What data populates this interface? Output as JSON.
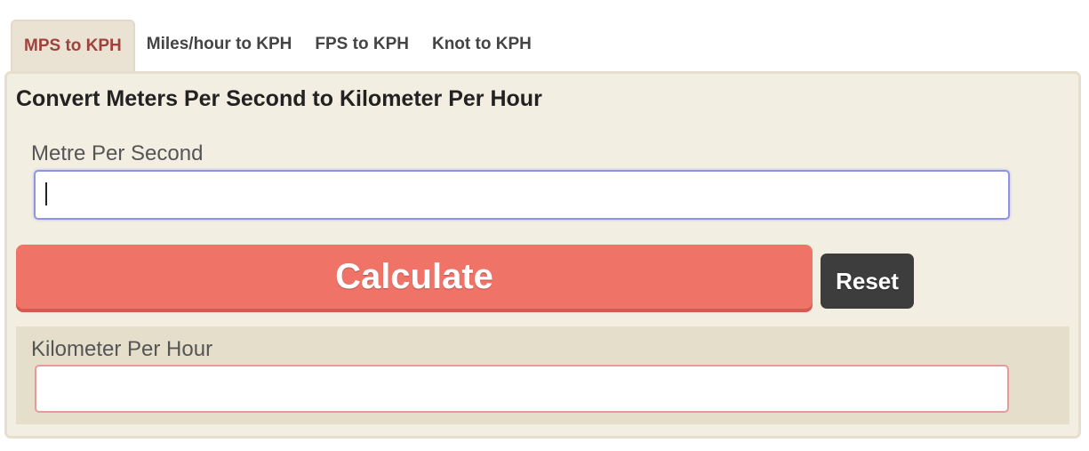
{
  "tabs": [
    {
      "label": "MPS to KPH",
      "active": true
    },
    {
      "label": "Miles/hour to KPH",
      "active": false
    },
    {
      "label": "FPS to KPH",
      "active": false
    },
    {
      "label": "Knot to KPH",
      "active": false
    }
  ],
  "converter": {
    "title": "Convert Meters Per Second to Kilometer Per Hour",
    "input_label": "Metre Per Second",
    "input_value": "",
    "calculate_label": "Calculate",
    "reset_label": "Reset",
    "result_label": "Kilometer Per Hour",
    "result_value": ""
  },
  "colors": {
    "active_tab_text": "#a0413d",
    "panel_bg": "#f2eee2",
    "calculate_bg": "#f07368",
    "reset_bg": "#3d3d3d",
    "result_bg": "#e5decb"
  }
}
